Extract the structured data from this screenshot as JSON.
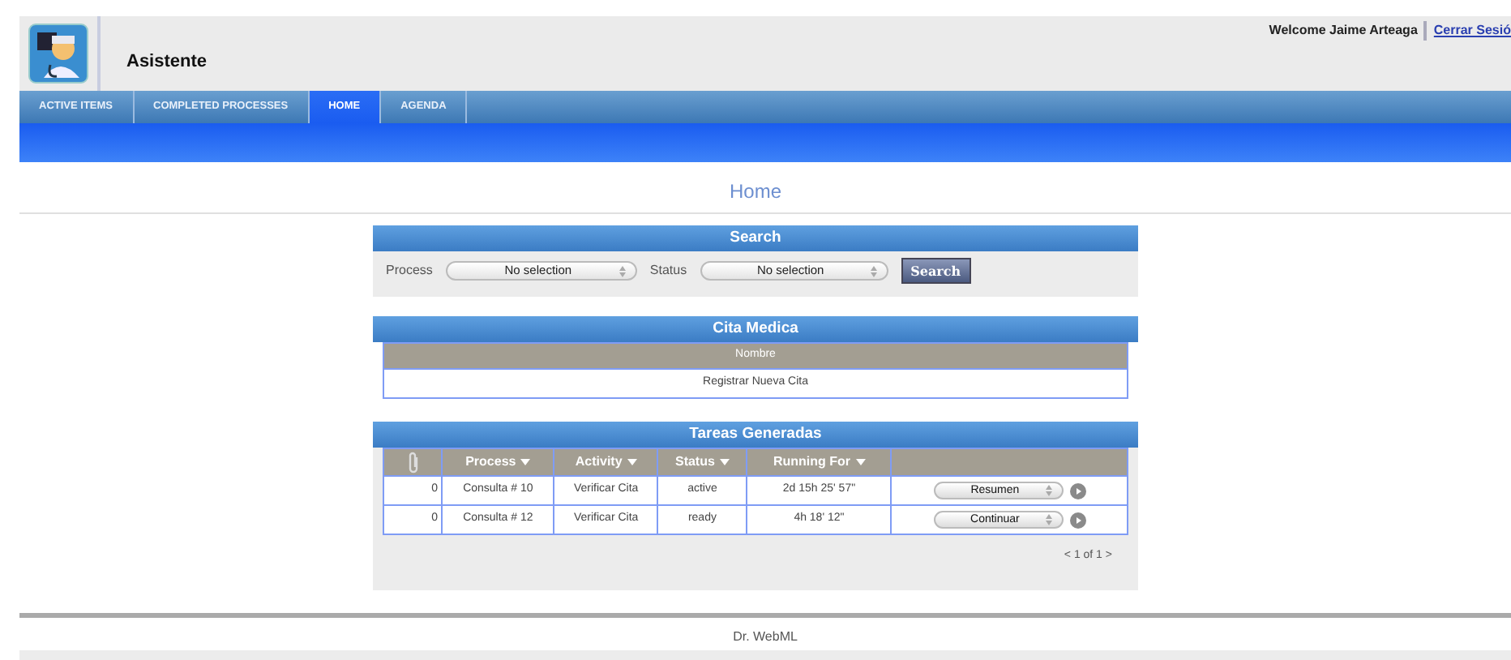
{
  "header": {
    "app_name": "Asistente",
    "welcome": "Welcome Jaime Arteaga",
    "logout": "Cerrar Sesió"
  },
  "tabs": [
    {
      "label": "ACTIVE ITEMS",
      "selected": false
    },
    {
      "label": "COMPLETED PROCESSES",
      "selected": false
    },
    {
      "label": "HOME",
      "selected": true
    },
    {
      "label": "AGENDA",
      "selected": false
    }
  ],
  "page_title": "Home",
  "search": {
    "title": "Search",
    "process_label": "Process",
    "process_value": "No selection",
    "status_label": "Status",
    "status_value": "No selection",
    "button": "Search"
  },
  "cita_medica": {
    "title": "Cita Medica",
    "columns": [
      "Nombre"
    ],
    "rows": [
      [
        "Registrar Nueva Cita"
      ]
    ]
  },
  "tareas": {
    "title": "Tareas Generadas",
    "columns": [
      "Process",
      "Activity",
      "Status",
      "Running For"
    ],
    "rows": [
      {
        "count": "0",
        "process": "Consulta # 10",
        "activity": "Verificar Cita",
        "status": "active",
        "running": "2d 15h 25' 57\"",
        "action": "Resumen"
      },
      {
        "count": "0",
        "process": "Consulta # 12",
        "activity": "Verificar Cita",
        "status": "ready",
        "running": "4h 18' 12\"",
        "action": "Continuar"
      }
    ],
    "pager": "< 1 of 1 >"
  },
  "footer": "Dr. WebML"
}
